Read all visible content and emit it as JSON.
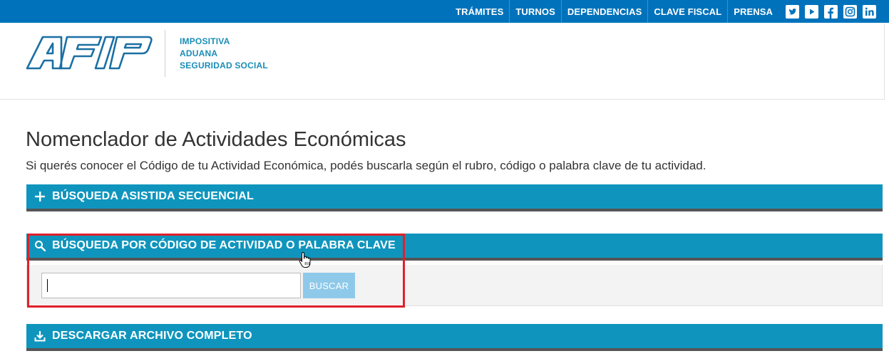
{
  "topnav": {
    "items": [
      {
        "label": "TRÁMITES"
      },
      {
        "label": "TURNOS"
      },
      {
        "label": "DEPENDENCIAS"
      },
      {
        "label": "CLAVE FISCAL"
      },
      {
        "label": "PRENSA"
      }
    ],
    "social_icons": [
      "twitter-icon",
      "youtube-icon",
      "facebook-icon",
      "instagram-icon",
      "linkedin-icon"
    ]
  },
  "header": {
    "logo_text": "AFIP",
    "tagline": [
      "IMPOSITIVA",
      "ADUANA",
      "SEGURIDAD SOCIAL"
    ]
  },
  "main": {
    "title": "Nomenclador de Actividades Económicas",
    "subtitle": "Si querés conocer el Código de tu Actividad Económica, podés buscarla según el rubro, código o palabra clave de tu actividad.",
    "panels": [
      {
        "label": "BÚSQUEDA ASISTIDA SECUENCIAL",
        "icon": "plus-icon"
      },
      {
        "label": "BÚSQUEDA POR CÓDIGO DE ACTIVIDAD O PALABRA CLAVE",
        "icon": "search-icon"
      },
      {
        "label": "DESCARGAR ARCHIVO COMPLETO",
        "icon": "download-icon"
      }
    ],
    "search": {
      "value": "",
      "placeholder": "",
      "button_label": "BUSCAR"
    }
  },
  "colors": {
    "topbar": "#0072bb",
    "panel": "#0f95bd",
    "tagline": "#1a8db8",
    "button": "#8fc9ea",
    "highlight": "#e0202a"
  }
}
